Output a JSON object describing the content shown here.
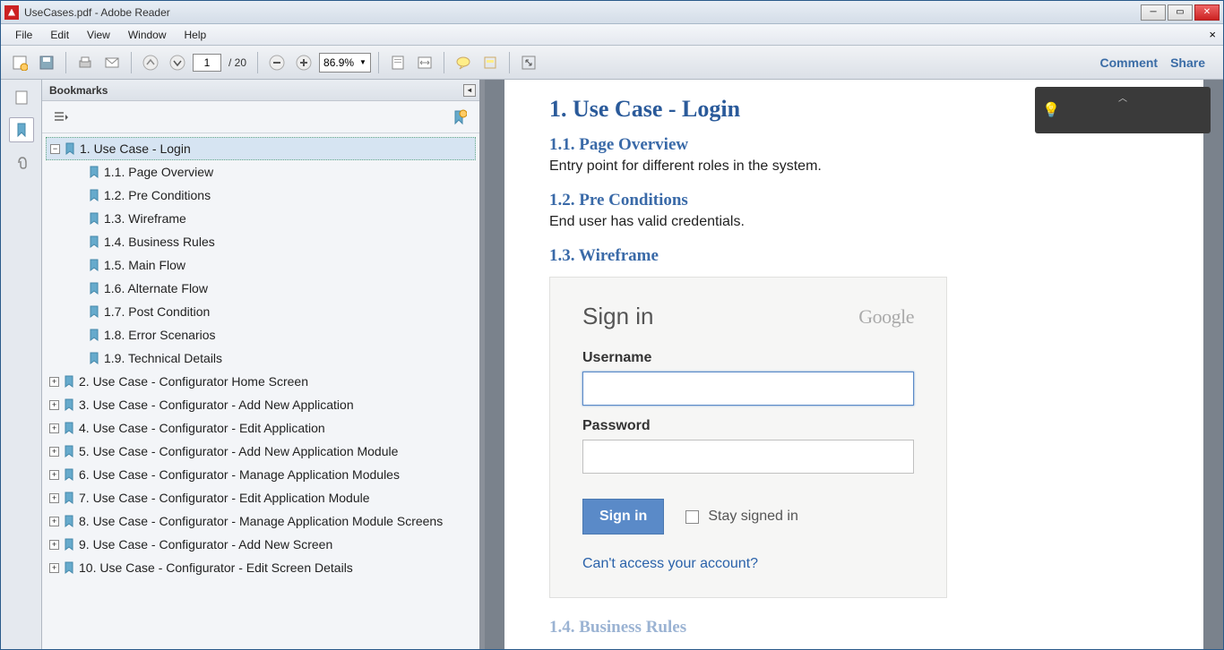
{
  "window": {
    "title": "UseCases.pdf - Adobe Reader"
  },
  "menubar": [
    "File",
    "Edit",
    "View",
    "Window",
    "Help"
  ],
  "toolbar": {
    "page_current": "1",
    "page_total": "/ 20",
    "zoom": "86.9%",
    "comment": "Comment",
    "share": "Share"
  },
  "bookmark_panel": {
    "title": "Bookmarks"
  },
  "bookmarks": {
    "root": {
      "label": "1. Use Case - Login",
      "children": [
        "1.1. Page Overview",
        "1.2. Pre Conditions",
        "1.3. Wireframe",
        "1.4. Business Rules",
        "1.5. Main Flow",
        "1.6. Alternate Flow",
        "1.7. Post Condition",
        "1.8. Error Scenarios",
        "1.9. Technical Details"
      ]
    },
    "siblings": [
      "2. Use Case - Configurator Home Screen",
      "3. Use Case - Configurator - Add New Application",
      "4. Use Case - Configurator - Edit Application",
      "5. Use Case - Configurator - Add New Application Module",
      "6. Use Case - Configurator - Manage Application Modules",
      "7. Use Case - Configurator - Edit Application Module",
      "8. Use Case - Configurator - Manage Application Module Screens",
      "9. Use Case - Configurator - Add New Screen",
      "10. Use Case - Configurator - Edit Screen Details"
    ]
  },
  "doc": {
    "h1": "1. Use Case - Login",
    "s11": "1.1. Page Overview",
    "s11_text": "Entry point for different roles in the system.",
    "s12": "1.2. Pre Conditions",
    "s12_text": "End user has valid credentials.",
    "s13": "1.3. Wireframe",
    "s14": "1.4. Business Rules"
  },
  "wireframe": {
    "title": "Sign in",
    "google": "Google",
    "username": "Username",
    "password": "Password",
    "signin": "Sign in",
    "stay": "Stay signed in",
    "cant_access": "Can't access your account?"
  }
}
